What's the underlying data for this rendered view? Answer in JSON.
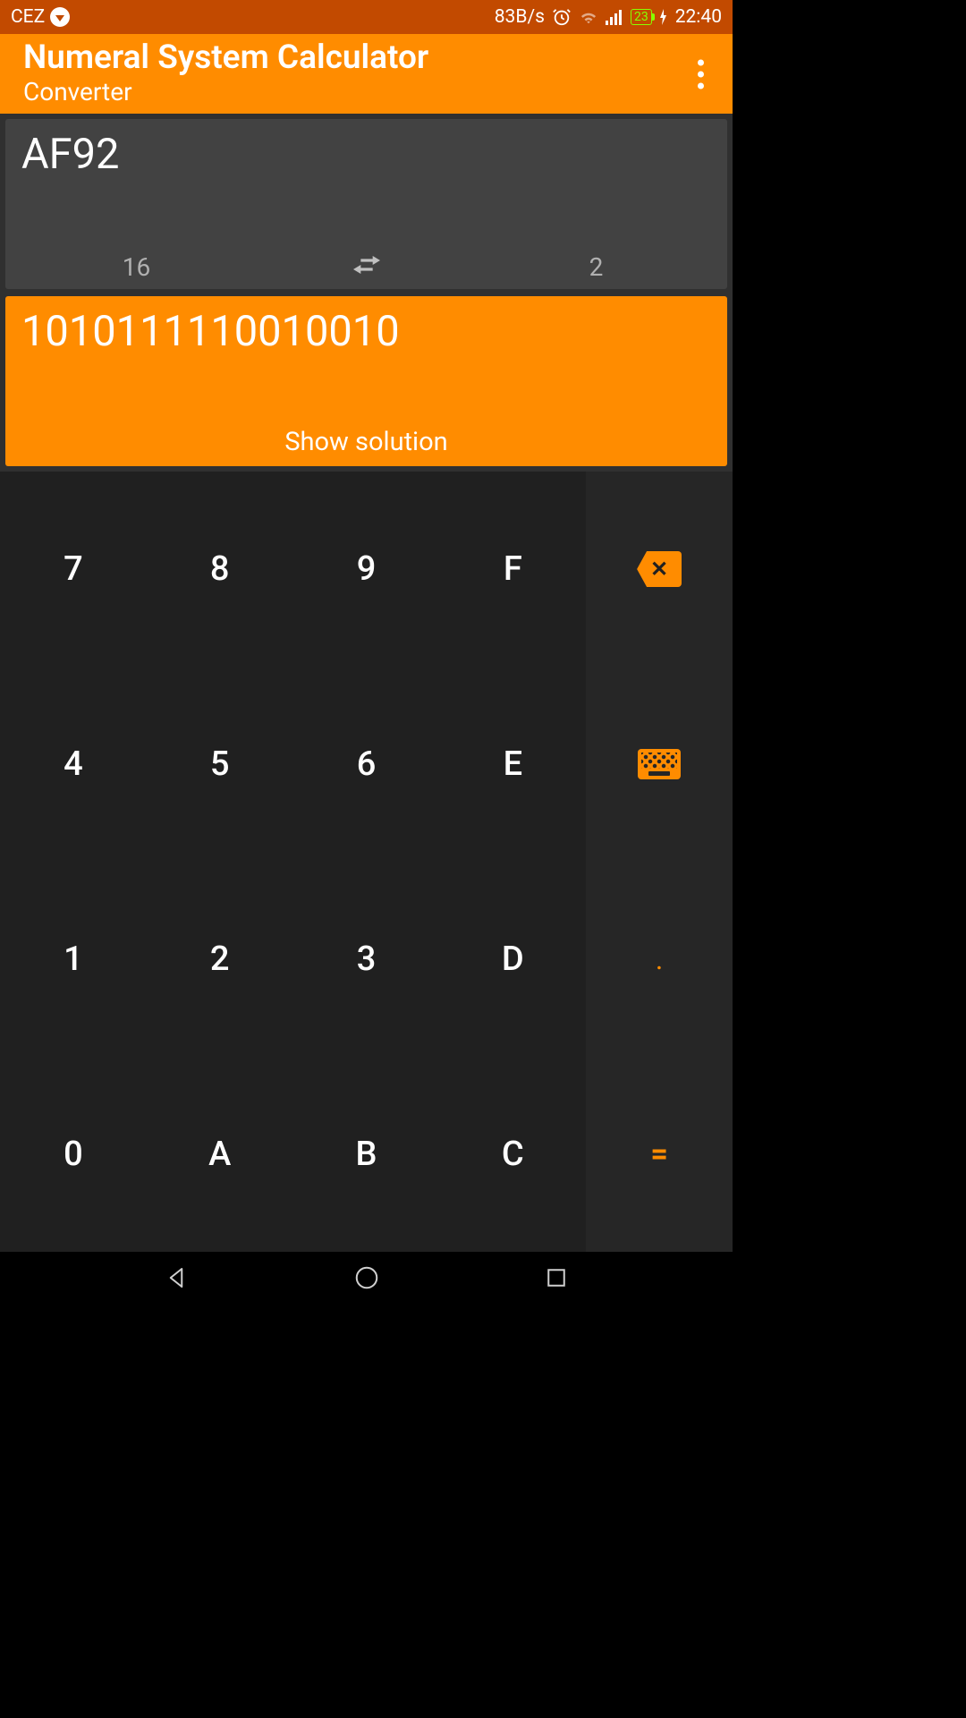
{
  "status_bar": {
    "carrier": "CEZ",
    "data_rate": "83B/s",
    "battery_percent": "23",
    "time": "22:40"
  },
  "app_bar": {
    "title": "Numeral System Calculator",
    "subtitle": "Converter"
  },
  "conversion": {
    "input_value": "AF92",
    "from_base": "16",
    "to_base": "2",
    "output_value": "1010111110010010",
    "show_solution_label": "Show solution"
  },
  "keypad": {
    "keys": [
      [
        "7",
        "8",
        "9",
        "F"
      ],
      [
        "4",
        "5",
        "6",
        "E"
      ],
      [
        "1",
        "2",
        "3",
        "D"
      ],
      [
        "0",
        "A",
        "B",
        "C"
      ]
    ],
    "side": {
      "backspace_glyph": "✕",
      "decimal_point": ".",
      "equals": "="
    }
  },
  "colors": {
    "accent": "#ff8c00",
    "accent_dark": "#c24a00",
    "surface": "#424242",
    "background": "#303030",
    "keypad": "#202020"
  }
}
